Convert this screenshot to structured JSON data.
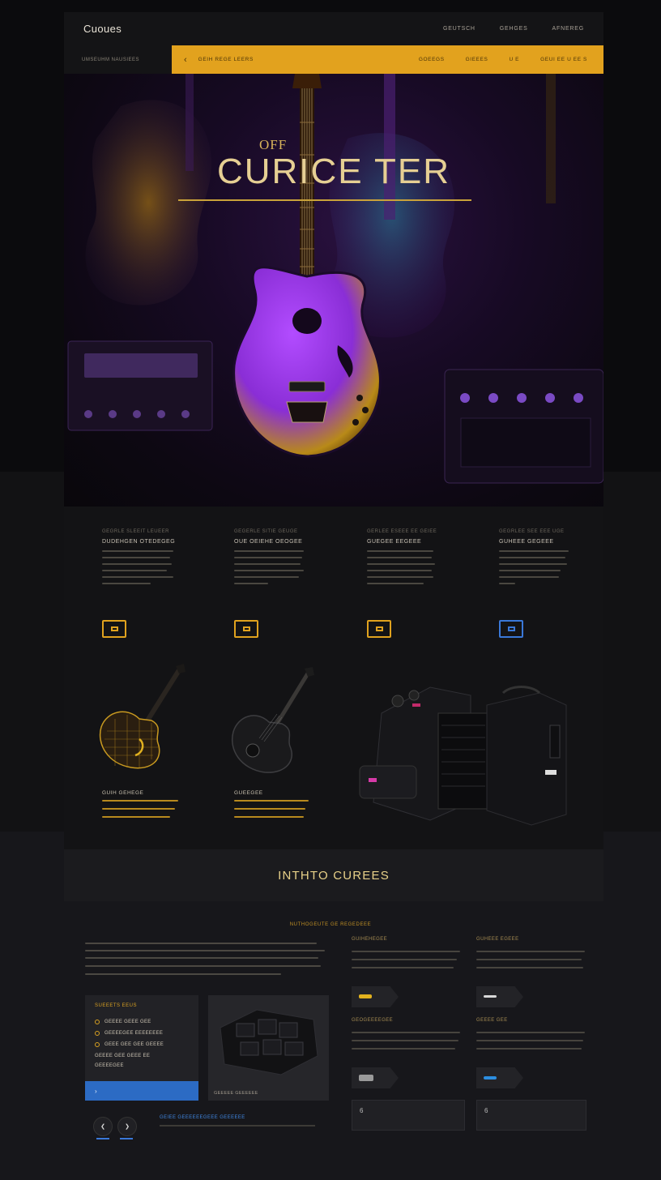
{
  "header": {
    "brand": "Cuoues",
    "nav": [
      "GEUTSCH",
      "GEHGES",
      "AFNEREG"
    ]
  },
  "subbar": {
    "left_label": "UMSEUHM NAUSIEES",
    "crumb": "GEIH REGE LEERS",
    "nav": [
      "GOEEGS",
      "GIEEES",
      "U E",
      "GEUI EE U EE S"
    ]
  },
  "hero": {
    "tag": "OFF",
    "title": "CURICE TER"
  },
  "features": [
    {
      "kicker": "GEGRLE SLEEIT LEUEER",
      "heading": "DUDEHGEN OTEDEGEG"
    },
    {
      "kicker": "GEGERLE SITIE GEUGE",
      "heading": "OUE OEIEHE OEOGEE"
    },
    {
      "kicker": "GERLEE ESEEE EE GEIEE",
      "heading": "GUEGEE EEGEEE"
    },
    {
      "kicker": "GEGRLEE SEE EEE UGE",
      "heading": "GUHEEE GEGEEE"
    }
  ],
  "products": [
    {
      "name": "GUIH GEHEGE"
    },
    {
      "name": "GUEEGEE"
    }
  ],
  "intro": {
    "title": "INTHTO CUREES",
    "kicker": "NUTHOGEUTE GE REGEDEEE"
  },
  "list_card": {
    "title": "SUEEETS EEUS",
    "items": [
      "GEEEE GEEE GEE",
      "GEEEEGEE EEEEEEEE",
      "GEEE GEE GEE GEEEE",
      "GEEEE GEE GEEE EE",
      "GEEEEGEE"
    ],
    "footer": "›"
  },
  "image_card": {
    "caption": "GEEEEE GEEEEEE"
  },
  "footer_link": "GEIEE GEEEEEEGEEE GEEEEEE",
  "right_cols": [
    {
      "title": "GUIHEHEGEE"
    },
    {
      "title": "GUHEEE EGEEE"
    },
    {
      "title": "GEOGEEEEGEE"
    },
    {
      "title": "GEEEE GEE"
    }
  ],
  "boxes": [
    "6",
    "6"
  ],
  "colors": {
    "accent": "#e2a21e",
    "blue": "#2c6bc4",
    "purple": "#8f3fd6"
  }
}
